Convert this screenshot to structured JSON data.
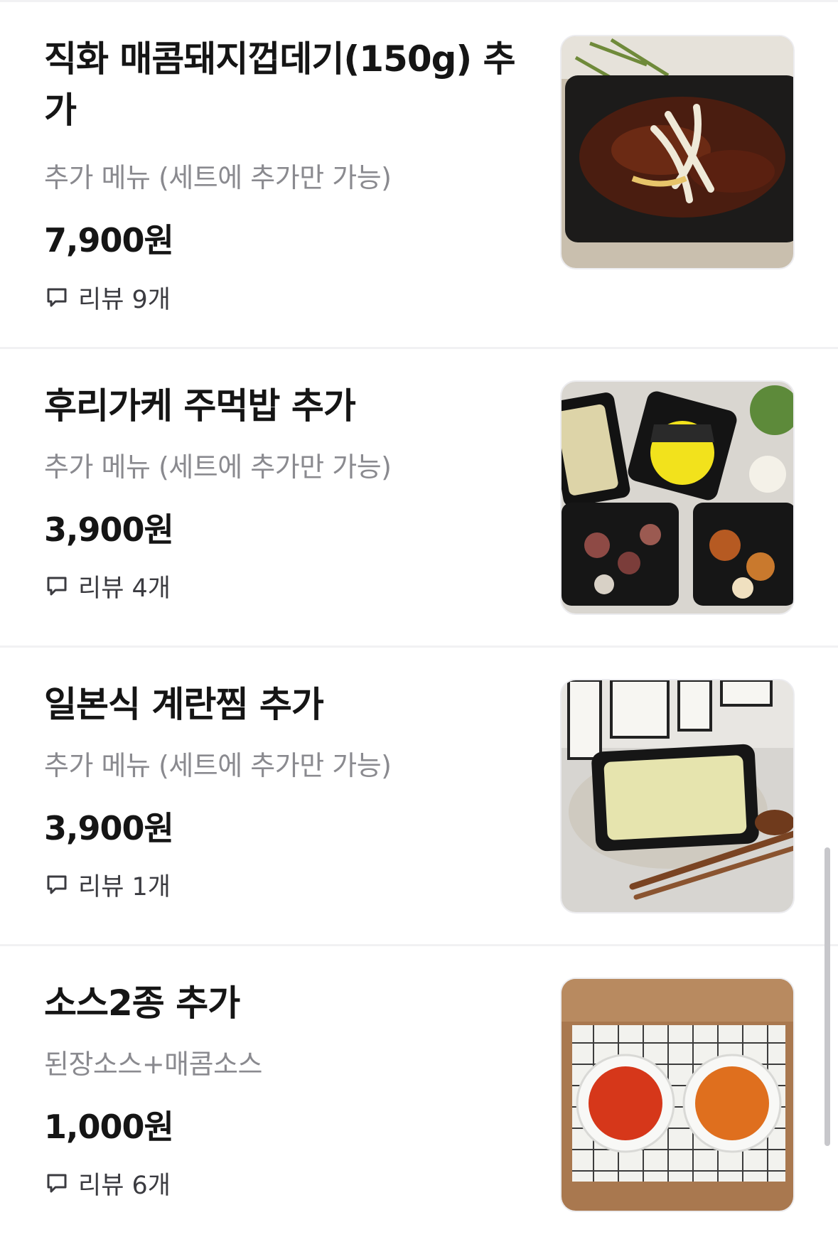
{
  "items": [
    {
      "name": "직화 매콤돼지껍데기(150g) 추가",
      "description": "추가 메뉴 (세트에 추가만 가능)",
      "price": "7,900원",
      "review": "리뷰 9개",
      "image": "spicy-pork-skin-photo"
    },
    {
      "name": "후리가케 주먹밥 추가",
      "description": "추가 메뉴 (세트에 추가만 가능)",
      "price": "3,900원",
      "review": "리뷰 4개",
      "image": "furikake-rice-ball-set-photo"
    },
    {
      "name": "일본식 계란찜 추가",
      "description": "추가 메뉴 (세트에 추가만 가능)",
      "price": "3,900원",
      "review": "리뷰 1개",
      "image": "japanese-steamed-egg-photo"
    },
    {
      "name": "소스2종 추가",
      "description": "된장소스+매콤소스",
      "price": "1,000원",
      "review": "리뷰 6개",
      "image": "two-sauces-photo"
    }
  ],
  "icons": {
    "review": "speech-bubble-icon"
  },
  "colors": {
    "text_primary": "#151515",
    "text_secondary": "#8a8a8f",
    "divider": "#f1f1f3"
  }
}
